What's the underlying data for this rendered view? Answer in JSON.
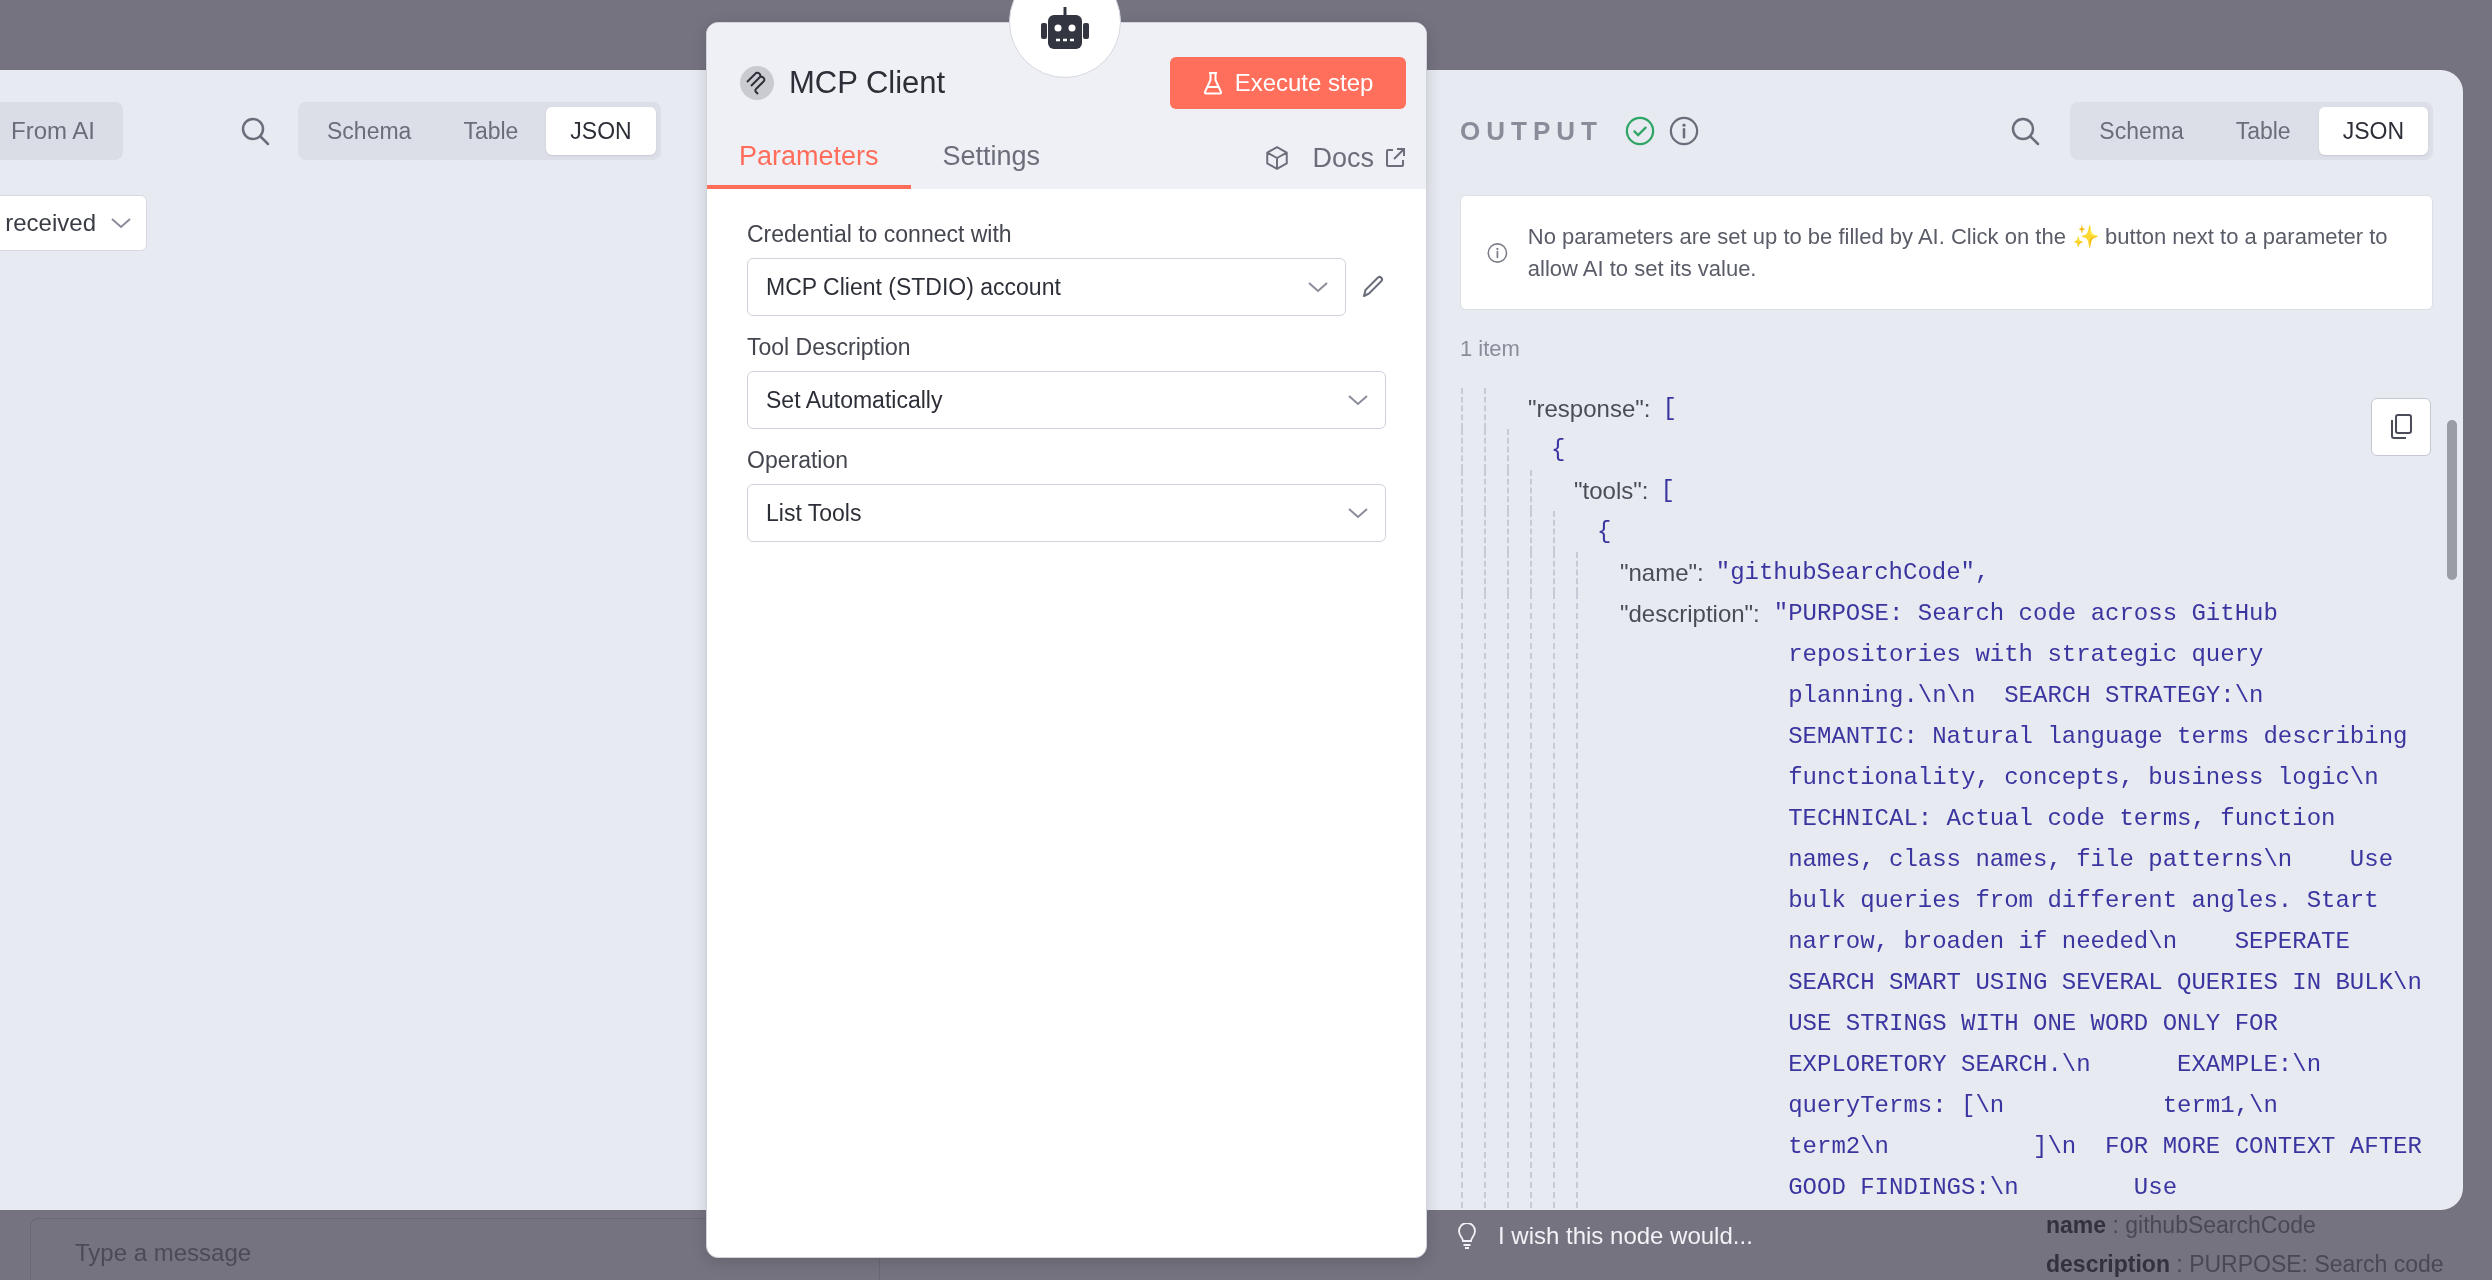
{
  "left_panel": {
    "mode_button": "From AI",
    "view_tabs": [
      {
        "label": "Schema",
        "selected": false
      },
      {
        "label": "Table",
        "selected": false
      },
      {
        "label": "JSON",
        "selected": true
      }
    ],
    "run_select": "received"
  },
  "node": {
    "title": "MCP Client",
    "execute_button": "Execute step",
    "tabs": [
      {
        "label": "Parameters",
        "selected": true
      },
      {
        "label": "Settings",
        "selected": false
      }
    ],
    "docs_link": "Docs",
    "fields": [
      {
        "label": "Credential to connect with",
        "value": "MCP Client (STDIO) account",
        "editable": true
      },
      {
        "label": "Tool Description",
        "value": "Set Automatically",
        "editable": false
      },
      {
        "label": "Operation",
        "value": "List Tools",
        "editable": false
      }
    ]
  },
  "output": {
    "title": "OUTPUT",
    "succeeded": true,
    "view_tabs": [
      {
        "label": "Schema",
        "selected": false
      },
      {
        "label": "Table",
        "selected": false
      },
      {
        "label": "JSON",
        "selected": true
      }
    ],
    "notice": "No parameters are set up to be filled by AI. Click on the ✨ button next to a parameter to allow AI to set its value.",
    "item_count": "1 item",
    "json_tree": [
      {
        "key": "\"response\":",
        "value": "[",
        "children": [
          {
            "value": "{",
            "children": [
              {
                "key": "\"tools\":",
                "value": "[",
                "children": [
                  {
                    "value": "{",
                    "children": [
                      {
                        "key": "\"name\":",
                        "value": "\"githubSearchCode\","
                      },
                      {
                        "key": "\"description\":",
                        "value_lines": [
                          "\"PURPOSE: Search code across GitHub",
                          "repositories with strategic query",
                          "planning.\\n\\n  SEARCH STRATEGY:\\n",
                          "SEMANTIC: Natural language terms describing",
                          "functionality, concepts, business logic\\n",
                          "TECHNICAL: Actual code terms, function",
                          "names, class names, file patterns\\n    Use",
                          "bulk queries from different angles. Start",
                          "narrow, broaden if needed\\n    SEPERATE",
                          "SEARCH SMART USING SEVERAL QUERIES IN BULK\\n",
                          "USE STRINGS WITH ONE WORD ONLY FOR",
                          "EXPLORETORY SEARCH.\\n      EXAMPLE:\\n",
                          "queryTerms: [\\n           term1,\\n",
                          "term2\\n          ]\\n  FOR MORE CONTEXT AFTER",
                          "GOOD FINDINGS:\\n        Use"
                        ]
                      }
                    ]
                  }
                ]
              }
            ]
          }
        ]
      }
    ]
  },
  "feedback": "I wish this node would...",
  "background": {
    "message_placeholder": "Type a message",
    "details": [
      {
        "key": "name",
        "value": " : githubSearchCode"
      },
      {
        "key": "description",
        "value": " : PURPOSE: Search code"
      }
    ]
  }
}
